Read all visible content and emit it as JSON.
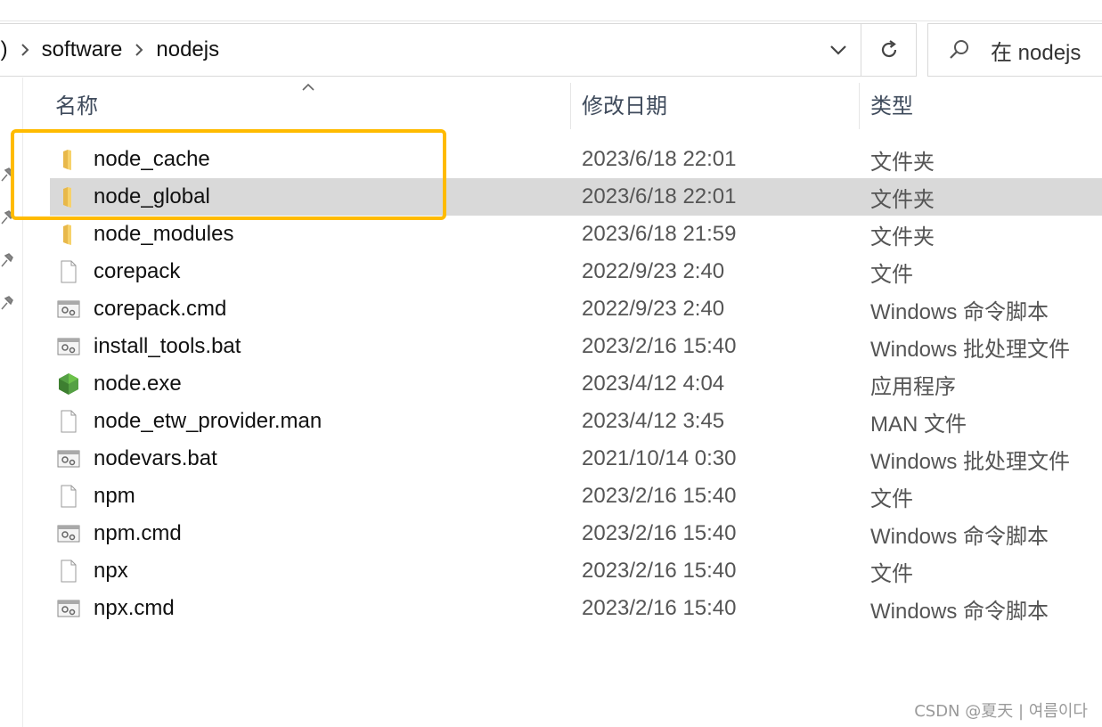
{
  "address_bar": {
    "crumbs": [
      ":)",
      "software",
      "nodejs"
    ],
    "separator": "›"
  },
  "search": {
    "placeholder": "在 nodejs"
  },
  "columns": {
    "name": "名称",
    "modified": "修改日期",
    "type": "类型"
  },
  "files": [
    {
      "name": "node_cache",
      "modified": "2023/6/18 22:01",
      "type": "文件夹",
      "icon": "folder-icon",
      "selected": false
    },
    {
      "name": "node_global",
      "modified": "2023/6/18 22:01",
      "type": "文件夹",
      "icon": "folder-icon",
      "selected": true
    },
    {
      "name": "node_modules",
      "modified": "2023/6/18 21:59",
      "type": "文件夹",
      "icon": "folder-icon",
      "selected": false
    },
    {
      "name": "corepack",
      "modified": "2022/9/23 2:40",
      "type": "文件",
      "icon": "file-icon",
      "selected": false
    },
    {
      "name": "corepack.cmd",
      "modified": "2022/9/23 2:40",
      "type": "Windows 命令脚本",
      "icon": "script-icon",
      "selected": false
    },
    {
      "name": "install_tools.bat",
      "modified": "2023/2/16 15:40",
      "type": "Windows 批处理文件",
      "icon": "script-icon",
      "selected": false
    },
    {
      "name": "node.exe",
      "modified": "2023/4/12 4:04",
      "type": "应用程序",
      "icon": "node-exe-icon",
      "selected": false
    },
    {
      "name": "node_etw_provider.man",
      "modified": "2023/4/12 3:45",
      "type": "MAN 文件",
      "icon": "file-icon",
      "selected": false
    },
    {
      "name": "nodevars.bat",
      "modified": "2021/10/14 0:30",
      "type": "Windows 批处理文件",
      "icon": "script-icon",
      "selected": false
    },
    {
      "name": "npm",
      "modified": "2023/2/16 15:40",
      "type": "文件",
      "icon": "file-icon",
      "selected": false
    },
    {
      "name": "npm.cmd",
      "modified": "2023/2/16 15:40",
      "type": "Windows 命令脚本",
      "icon": "script-icon",
      "selected": false
    },
    {
      "name": "npx",
      "modified": "2023/2/16 15:40",
      "type": "文件",
      "icon": "file-icon",
      "selected": false
    },
    {
      "name": "npx.cmd",
      "modified": "2023/2/16 15:40",
      "type": "Windows 命令脚本",
      "icon": "script-icon",
      "selected": false
    }
  ],
  "highlight_color": "#ffbb00",
  "selection_color": "#d9d9d9",
  "watermark": "CSDN @夏天 | 여름이다"
}
